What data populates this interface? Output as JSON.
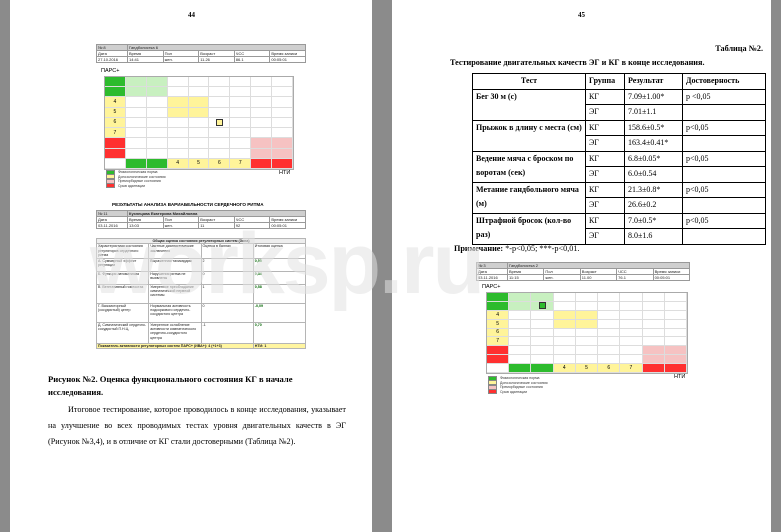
{
  "page_left": {
    "page_number": "44",
    "fig_top": {
      "header": [
        "№ 8",
        "Гандболистка 6",
        "",
        "",
        "",
        "",
        ""
      ],
      "labels": [
        "Дата",
        "Время",
        "Пол",
        "Возраст",
        "ЧСС",
        "Время записи"
      ],
      "values": [
        "27.10.2016",
        "14:41",
        "жен.",
        "11.26",
        "86.1",
        "00:05:01"
      ],
      "pars_label": "ПАРС+",
      "hti_label": "НТИ",
      "legend": [
        {
          "label": "Физиологическая норма",
          "color": "#2dbb2d"
        },
        {
          "label": "Донозологические состояния",
          "color": "#fff49a"
        },
        {
          "label": "Преморбидные состояния",
          "color": "#f6c2c2"
        },
        {
          "label": "Срыв адаптации",
          "color": "#ff3030"
        }
      ]
    },
    "results_title": "РЕЗУЛЬТАТЫ АНАЛИЗА ВАРИАБЕЛЬНОСТИ СЕРДЕЧНОГО РИТМА",
    "person": {
      "num": "№ 11",
      "name": "Кузнецова Екатерина Михайловна",
      "labels": [
        "Дата",
        "Время",
        "Пол",
        "Возраст",
        "ЧСС",
        "Время записи"
      ],
      "values": [
        "03.11.2016",
        "13:03",
        "жен.",
        "11",
        "92",
        "00:05:01"
      ]
    },
    "reg_table": {
      "title": "Общая оценка состояния регуляторных систем (Зона)",
      "headers": [
        "Характеристики состояния регуляторов сердечного ритма",
        "Частные диагностические заключения",
        "Оценка в баллах",
        "Итоговая оценка"
      ],
      "rows": [
        {
          "char": "А. Суммарный эффект регуляции",
          "concl": "Выраженная тахикардия",
          "score": "2",
          "total": "0,55"
        },
        {
          "char": "Б. Функция автоматизма",
          "concl": "Нарушения ритма не выявлены",
          "score": "0",
          "total": "0,34"
        },
        {
          "char": "В. Вегетативный гомеостаз",
          "concl": "Умеренное преобладание симпатической нервной системы",
          "score": "1",
          "total": "0,58"
        },
        {
          "char": "Г. Вазомоторный (сосудистый) центр",
          "concl": "Нормальная активность подкоркового сердечно-сосудистого центра",
          "score": "0",
          "total": "-0,09"
        },
        {
          "char": "Д. Симпатический сердечно-сосудистый П.Н.Ц.",
          "concl": "Умеренное ослабление активности симпатического сердечно-сосудистого центра",
          "score": "-1",
          "total": "0,70"
        }
      ],
      "footer_label": "Показатель активности регуляторных систем ПАРС+ (ИВА+): 4 (+1+3)",
      "footer_value": "НТИ: 1"
    },
    "caption": "Рисунок №2. Оценка функционального состояния КГ в начале исследования.",
    "paragraph": "Итоговое тестирование, которое проводилось в конце исследования, указывает на улучшение во всех проводимых тестах уровня двигательных качеств в ЭГ (Рисунок №3,4), и в отличие от КГ стали достоверными (Таблица №2)."
  },
  "page_right": {
    "page_number": "45",
    "table_number": "Таблица №2.",
    "table_title": "Тестирование двигательных качеств ЭГ и КГ в конце исследования.",
    "columns": [
      "Тест",
      "Группа",
      "Результат",
      "Достоверность"
    ],
    "rows": [
      {
        "test": "Бег 30 м (с)",
        "groups": [
          [
            "КГ",
            "7.09±1.00*",
            "р <0,05"
          ],
          [
            "ЭГ",
            "7.01±1.1",
            ""
          ]
        ]
      },
      {
        "test": "Прыжок в длину с места (см)",
        "groups": [
          [
            "КГ",
            "158.6±0.5*",
            "р<0,05"
          ],
          [
            "ЭГ",
            "163.4±0.41*",
            ""
          ]
        ]
      },
      {
        "test": "Ведение мяча с броском по воротам (сек)",
        "groups": [
          [
            "КГ",
            "6.8±0.05*",
            "р<0,05"
          ],
          [
            "ЭГ",
            "6.0±0.54",
            ""
          ]
        ]
      },
      {
        "test": "Метание гандбольного мяча (м)",
        "groups": [
          [
            "КГ",
            "21.3±0.8*",
            "р<0,05"
          ],
          [
            "ЭГ",
            "26.6±0.2",
            ""
          ]
        ]
      },
      {
        "test": "Штрафной бросок (кол-во раз)",
        "groups": [
          [
            "КГ",
            "7.0±0.5*",
            "р<0,05"
          ],
          [
            "ЭГ",
            "8.0±1.6",
            ""
          ]
        ]
      }
    ],
    "note_label": "Примечание:",
    "note_text": "*-р<0,05; ***-р<0,01.",
    "fig_bottom": {
      "header": [
        "№ 3",
        "Гандболистка 2"
      ],
      "labels": [
        "Дата",
        "Время",
        "Пол",
        "Возраст",
        "ЧСС",
        "Время записи"
      ],
      "values": [
        "03.11.2016",
        "11:15",
        "жен.",
        "11.00",
        "76.1",
        "00:05:01"
      ],
      "pars_label": "ПАРС+",
      "hti_label": "НТИ",
      "legend": [
        {
          "label": "Физиологическая норма",
          "color": "#2dbb2d"
        },
        {
          "label": "Донозологические состояния",
          "color": "#fff49a"
        },
        {
          "label": "Преморбидные состояния",
          "color": "#f6c2c2"
        },
        {
          "label": "Срыв адаптации",
          "color": "#ff3030"
        }
      ]
    }
  },
  "watermark": "worksp.ru",
  "grid": {
    "left_y_labels": [
      "",
      "",
      "4",
      "5",
      "6",
      "7",
      "",
      "",
      ""
    ],
    "bottom_x_labels": [
      "",
      "",
      "",
      "4",
      "5",
      "6",
      "7",
      "",
      ""
    ]
  },
  "colors": {
    "green": "#2dbb2d",
    "light_green": "#c8f0c0",
    "yellow": "#fff49a",
    "pink": "#f6c2c2",
    "red": "#ff3030"
  }
}
